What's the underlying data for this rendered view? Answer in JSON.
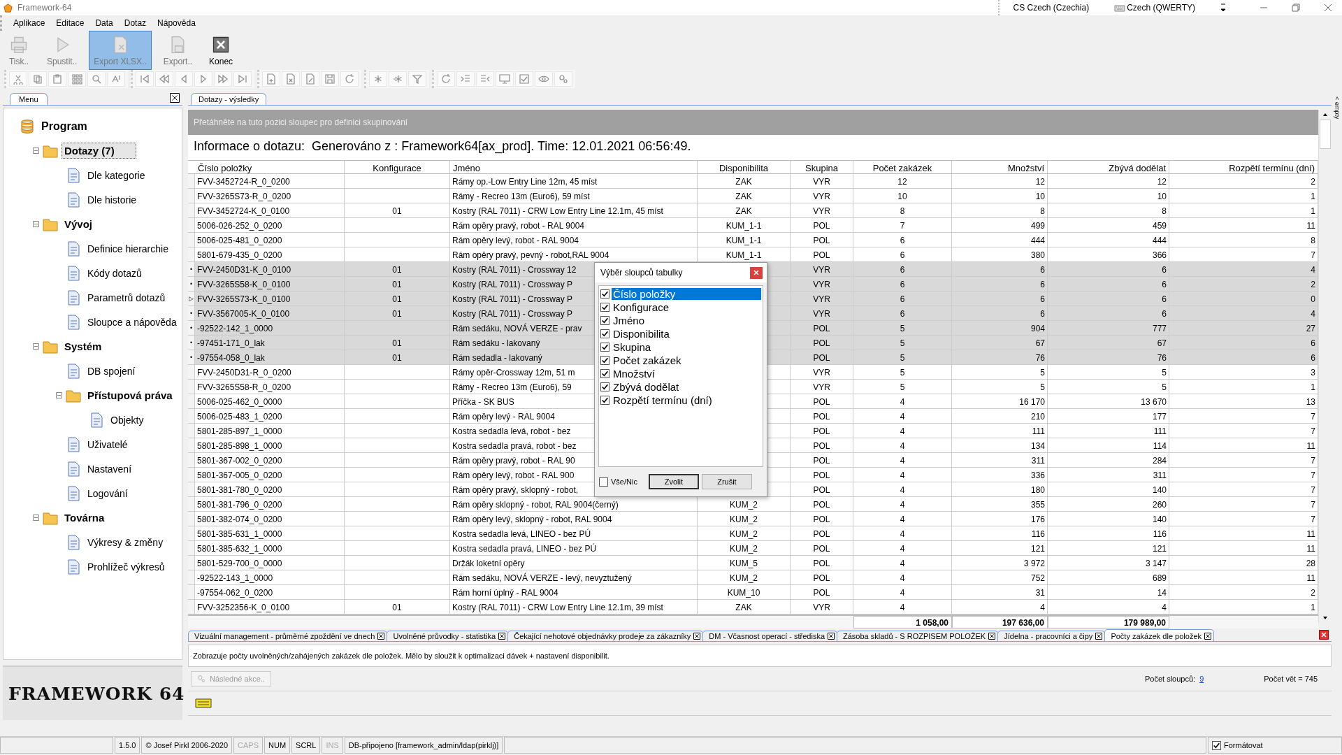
{
  "window": {
    "title": "Framework-64"
  },
  "language_bar": {
    "language": "CS Czech (Czechia)",
    "keyboard": "Czech (QWERTY)"
  },
  "menu": [
    "Aplikace",
    "Editace",
    "Data",
    "Dotaz",
    "Nápověda"
  ],
  "toolbar": [
    {
      "label": "Tisk..",
      "disabled": true,
      "selected": false
    },
    {
      "label": "Spustit..",
      "disabled": true,
      "selected": false
    },
    {
      "label": "Export XLSX..",
      "disabled": true,
      "selected": true
    },
    {
      "label": "Export..",
      "disabled": true,
      "selected": false
    },
    {
      "label": "Konec",
      "disabled": false,
      "selected": false
    }
  ],
  "sidebar": {
    "tab": "Menu",
    "tree": [
      {
        "label": "Program",
        "selected": false,
        "children": [
          {
            "label": "Dotazy (7)",
            "expanded": true,
            "selected": true,
            "children": [
              {
                "label": "Dle kategorie",
                "selected": false
              },
              {
                "label": "Dle historie",
                "selected": false
              }
            ]
          },
          {
            "label": "Vývoj",
            "expanded": true,
            "selected": false,
            "children": [
              {
                "label": "Definice hierarchie",
                "selected": false
              },
              {
                "label": "Kódy dotazů",
                "selected": false
              },
              {
                "label": "Parametrů dotazů",
                "selected": false
              },
              {
                "label": "Sloupce a nápověda",
                "selected": false
              }
            ]
          },
          {
            "label": "Systém",
            "expanded": true,
            "selected": false,
            "children": [
              {
                "label": "DB spojení",
                "selected": false
              },
              {
                "label": "Přístupová práva",
                "expanded": true,
                "selected": false,
                "children": [
                  {
                    "label": "Objekty",
                    "selected": false
                  }
                ]
              },
              {
                "label": "Uživatelé",
                "selected": false
              },
              {
                "label": "Nastavení",
                "selected": false
              },
              {
                "label": "Logování",
                "selected": false
              }
            ]
          },
          {
            "label": "Továrna",
            "expanded": true,
            "selected": false,
            "children": [
              {
                "label": "Výkresy & změny",
                "selected": false
              },
              {
                "label": "Prohlížeč výkresů",
                "selected": false
              }
            ]
          }
        ]
      }
    ],
    "logo": "FRAMEWORK 64"
  },
  "results_tab": "Dotazy - výsledky",
  "group_hint": "Přetáhněte na tuto pozici sloupec pro definici skupinování",
  "info": "Informace o dotazu:  Generováno z : Framework64[ax_prod]. Time: 12.01.2021 06:56:49.",
  "table": {
    "columns": [
      "Číslo položky",
      "Konfigurace",
      "Jméno",
      "Disponibilita",
      "Skupina",
      "Počet zakázek",
      "Množství",
      "Zbývá dodělat",
      "Rozpětí termínu (dní)"
    ],
    "rows": [
      {
        "selected": false,
        "item": "FVV-3452724-R_0_0200",
        "name": "Rámy op.-Low Entry Line 12m, 45 míst",
        "availability": "ZAK",
        "group": "VYR",
        "orders": "12",
        "quantity": "12",
        "remaining": "12",
        "span": "2"
      },
      {
        "selected": false,
        "item": "FVV-3265S73-R_0_0200",
        "name": "Rámy - Recreo 13m (Euro6), 59 míst",
        "availability": "ZAK",
        "group": "VYR",
        "orders": "10",
        "quantity": "10",
        "remaining": "10",
        "span": "1"
      },
      {
        "selected": false,
        "item": "FVV-3452724-K_0_0100",
        "config": "01",
        "name": "Kostry (RAL 7011) - CRW Low Entry Line 12.1m, 45 míst",
        "availability": "ZAK",
        "group": "VYR",
        "orders": "8",
        "quantity": "8",
        "remaining": "8",
        "span": "1"
      },
      {
        "selected": false,
        "item": "5006-026-252_0_0200",
        "name": "Rám opěry pravý, robot - RAL 9004",
        "availability": "KUM_1-1",
        "group": "POL",
        "orders": "7",
        "quantity": "499",
        "remaining": "459",
        "span": "11"
      },
      {
        "selected": false,
        "item": "5006-025-481_0_0200",
        "name": "Rám opěry levý, robot - RAL 9004",
        "availability": "KUM_1-1",
        "group": "POL",
        "orders": "6",
        "quantity": "444",
        "remaining": "444",
        "span": "8"
      },
      {
        "selected": false,
        "item": "5801-679-435_0_0200",
        "name": "Rám opěry pravý, pevný - robot,RAL 9004",
        "availability": "KUM_1-1",
        "group": "POL",
        "orders": "6",
        "quantity": "380",
        "remaining": "366",
        "span": "7"
      },
      {
        "selected": true,
        "indicator": "•",
        "item": "FVV-2450D31-K_0_0100",
        "config": "01",
        "name": "Kostry (RAL 7011) - Crossway 12",
        "group": "VYR",
        "orders": "6",
        "quantity": "6",
        "remaining": "6",
        "span": "4"
      },
      {
        "selected": true,
        "indicator": "•",
        "item": "FVV-3265S58-K_0_0100",
        "config": "01",
        "name": "Kostry (RAL 7011) - Crossway P",
        "group": "VYR",
        "orders": "6",
        "quantity": "6",
        "remaining": "6",
        "span": "2"
      },
      {
        "selected": true,
        "indicator": "▷",
        "item": "FVV-3265S73-K_0_0100",
        "config": "01",
        "name": "Kostry (RAL 7011) - Crossway P",
        "group": "VYR",
        "orders": "6",
        "quantity": "6",
        "remaining": "6",
        "span": "0"
      },
      {
        "selected": true,
        "indicator": "•",
        "item": "FVV-3567005-K_0_0100",
        "config": "01",
        "name": "Kostry (RAL 7011) - Crossway P",
        "group": "VYR",
        "orders": "6",
        "quantity": "6",
        "remaining": "6",
        "span": "4"
      },
      {
        "selected": true,
        "indicator": "•",
        "item": "-92522-142_1_0000",
        "name": "Rám sedáku, NOVÁ VERZE - prav",
        "group": "POL",
        "orders": "5",
        "quantity": "904",
        "remaining": "777",
        "span": "27"
      },
      {
        "selected": true,
        "indicator": "•",
        "item": "-97451-171_0_lak",
        "config": "01",
        "name": "Rám sedáku - lakovaný",
        "group": "POL",
        "orders": "5",
        "quantity": "67",
        "remaining": "67",
        "span": "6"
      },
      {
        "selected": true,
        "indicator": "•",
        "item": "-97554-058_0_lak",
        "config": "01",
        "name": "Rám sedadla - lakovaný",
        "group": "POL",
        "orders": "5",
        "quantity": "76",
        "remaining": "76",
        "span": "6"
      },
      {
        "selected": false,
        "item": "FVV-2450D31-R_0_0200",
        "name": "Rámy opěr-Crossway 12m, 51 m",
        "group": "VYR",
        "orders": "5",
        "quantity": "5",
        "remaining": "5",
        "span": "3"
      },
      {
        "selected": false,
        "item": "FVV-3265S58-R_0_0200",
        "name": "Rámy - Recreo 13m (Euro6), 59",
        "group": "VYR",
        "orders": "5",
        "quantity": "5",
        "remaining": "5",
        "span": "1"
      },
      {
        "selected": false,
        "item": "5006-025-462_0_0000",
        "name": "Příčka - SK BUS",
        "group": "POL",
        "orders": "4",
        "quantity": "16 170",
        "remaining": "13 670",
        "span": "13"
      },
      {
        "selected": false,
        "item": "5006-025-483_1_0200",
        "name": "Rám opěry levý - RAL 9004",
        "group": "POL",
        "orders": "4",
        "quantity": "210",
        "remaining": "177",
        "span": "7"
      },
      {
        "selected": false,
        "item": "5801-285-897_1_0000",
        "name": "Kostra sedadla levá, robot - bez",
        "group": "POL",
        "orders": "4",
        "quantity": "111",
        "remaining": "111",
        "span": "7"
      },
      {
        "selected": false,
        "item": "5801-285-898_1_0000",
        "name": "Kostra sedadla pravá, robot - bez",
        "group": "POL",
        "orders": "4",
        "quantity": "134",
        "remaining": "114",
        "span": "11"
      },
      {
        "selected": false,
        "item": "5801-367-002_0_0200",
        "name": "Rám opěry pravý, robot - RAL 90",
        "group": "POL",
        "orders": "4",
        "quantity": "311",
        "remaining": "284",
        "span": "7"
      },
      {
        "selected": false,
        "item": "5801-367-005_0_0200",
        "name": "Rám opěry levý, robot - RAL 900",
        "group": "POL",
        "orders": "4",
        "quantity": "336",
        "remaining": "311",
        "span": "7"
      },
      {
        "selected": false,
        "item": "5801-381-780_0_0200",
        "name": "Rám opěry pravý, sklopný - robot,",
        "group": "POL",
        "orders": "4",
        "quantity": "180",
        "remaining": "140",
        "span": "7"
      },
      {
        "selected": false,
        "item": "5801-381-796_0_0200",
        "name": "Rám opěry sklopný - robot, RAL 9004(černý)",
        "availability": "KUM_2",
        "group": "POL",
        "orders": "4",
        "quantity": "355",
        "remaining": "260",
        "span": "7"
      },
      {
        "selected": false,
        "item": "5801-382-074_0_0200",
        "name": "Rám opěry levý, sklopný - robot, RAL 9004",
        "availability": "KUM_2",
        "group": "POL",
        "orders": "4",
        "quantity": "176",
        "remaining": "140",
        "span": "7"
      },
      {
        "selected": false,
        "item": "5801-385-631_1_0000",
        "name": "Kostra sedadla levá, LINEO - bez PÚ",
        "availability": "KUM_2",
        "group": "POL",
        "orders": "4",
        "quantity": "116",
        "remaining": "116",
        "span": "11"
      },
      {
        "selected": false,
        "item": "5801-385-632_1_0000",
        "name": "Kostra sedadla pravá, LINEO - bez PÚ",
        "availability": "KUM_2",
        "group": "POL",
        "orders": "4",
        "quantity": "121",
        "remaining": "121",
        "span": "11"
      },
      {
        "selected": false,
        "item": "5801-529-700_0_0000",
        "name": "Držák loketní opěry",
        "availability": "KUM_5",
        "group": "POL",
        "orders": "4",
        "quantity": "3 972",
        "remaining": "3 147",
        "span": "28"
      },
      {
        "selected": false,
        "item": "-92522-143_1_0000",
        "name": "Rám sedáku, NOVÁ VERZE - levý, nevyztužený",
        "availability": "KUM_2",
        "group": "POL",
        "orders": "4",
        "quantity": "752",
        "remaining": "689",
        "span": "11"
      },
      {
        "selected": false,
        "item": "-97554-062_0_0200",
        "name": "Rám horní úplný - RAL 9004",
        "availability": "KUM_10",
        "group": "POL",
        "orders": "4",
        "quantity": "31",
        "remaining": "14",
        "span": "2"
      },
      {
        "selected": false,
        "item": "FVV-3252356-K_0_0100",
        "config": "01",
        "name": "Kostry (RAL 7011) - CRW Low Entry Line 12.1m, 39 míst",
        "availability": "ZAK",
        "group": "VYR",
        "orders": "4",
        "quantity": "4",
        "remaining": "4",
        "span": "1"
      }
    ],
    "totals": {
      "orders": "1 058,00",
      "quantity": "197 636,00",
      "remaining": "179 989,00"
    }
  },
  "side_tab": "< empty",
  "dialog": {
    "title": "Výběr sloupců tabulky",
    "items": [
      {
        "label": "Číslo položky",
        "checked": true,
        "selected": true
      },
      {
        "label": "Konfigurace",
        "checked": true,
        "selected": false
      },
      {
        "label": "Jméno",
        "checked": true,
        "selected": false
      },
      {
        "label": "Disponibilita",
        "checked": true,
        "selected": false
      },
      {
        "label": "Skupina",
        "checked": true,
        "selected": false
      },
      {
        "label": "Počet zakázek",
        "checked": true,
        "selected": false
      },
      {
        "label": "Množství",
        "checked": true,
        "selected": false
      },
      {
        "label": "Zbývá dodělat",
        "checked": true,
        "selected": false
      },
      {
        "label": "Rozpětí termínu (dní)",
        "checked": true,
        "selected": false
      }
    ],
    "select_all": {
      "label": "Vše/Nic",
      "checked": false
    },
    "buttons": [
      "Zvolit",
      "Zrušit"
    ]
  },
  "query_tabs": [
    {
      "label": "Vizuální management - průměrné zpoždění ve dnech",
      "selected": false
    },
    {
      "label": "Uvolněné průvodky - statistika",
      "selected": false
    },
    {
      "label": "Čekající nehotové objednávky prodeje za zákazníky",
      "selected": false
    },
    {
      "label": "DM - Včasnost operací - střediska",
      "selected": false
    },
    {
      "label": "Zásoba skladů - S ROZPISEM POLOŽEK",
      "selected": false
    },
    {
      "label": "Jídelna - pracovníci a čipy",
      "selected": false
    },
    {
      "label": "Počty zakázek dle položek",
      "selected": true
    }
  ],
  "description": "Zobrazuje počty uvolněných/zahájených zakázek dle položek. Mělo by sloužit k optimalizaci dávek + nastavení disponibilit.",
  "action_button": {
    "label": "Následné akce..",
    "disabled": true
  },
  "column_count": {
    "label": "Počet sloupců:",
    "value": "9"
  },
  "record_count": "Počet vět = 745",
  "status_bar": {
    "version": "1.5.0",
    "copyright": "© Josef Pirkl 2006-2020",
    "indicators": [
      {
        "label": "CAPS",
        "on": false
      },
      {
        "label": "NUM",
        "on": true
      },
      {
        "label": "SCRL",
        "on": true
      },
      {
        "label": "INS",
        "on": false
      }
    ],
    "connection": "DB-připojeno [framework_admin/ldap(pirklj)]",
    "format": {
      "label": "Formátovat",
      "checked": true
    }
  }
}
